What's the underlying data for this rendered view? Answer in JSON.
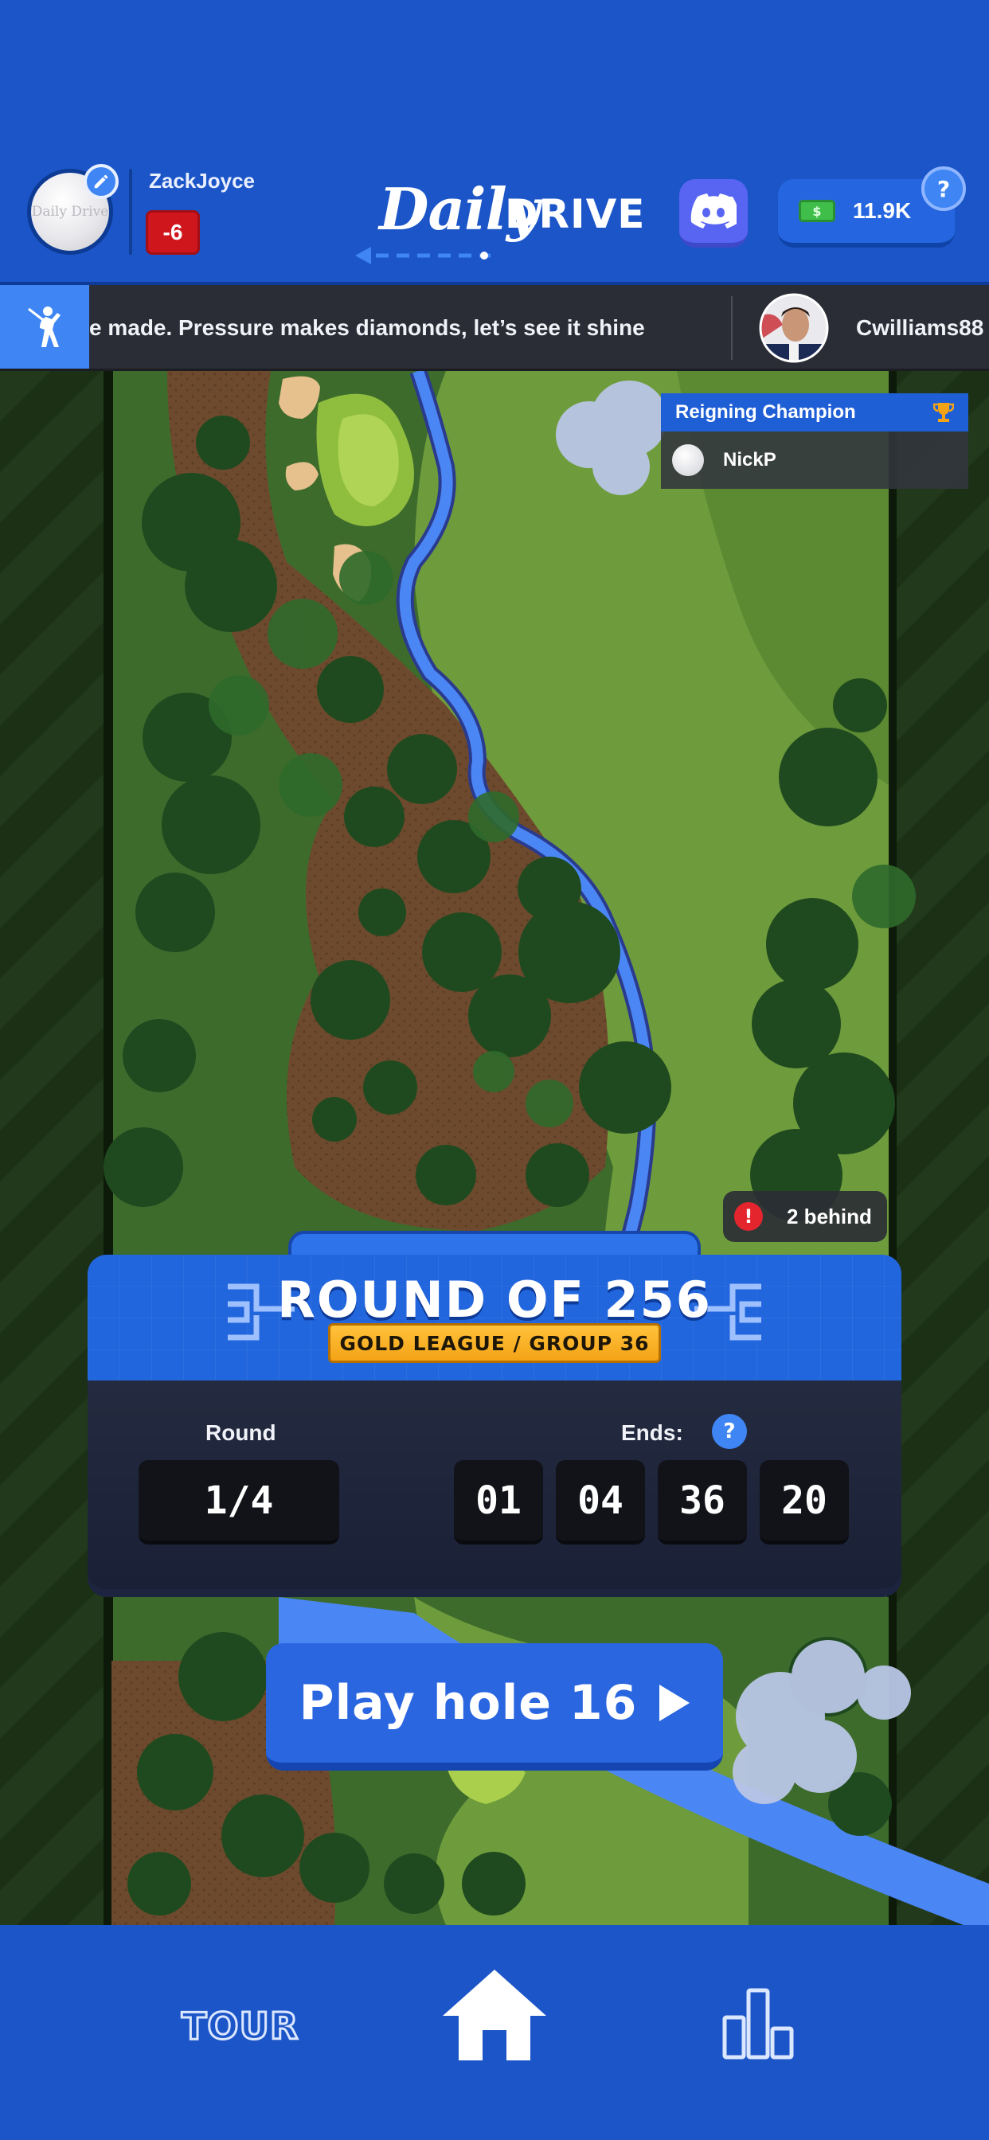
{
  "header": {
    "username": "ZackJoyce",
    "score": "-6",
    "avatar_logo": "Daily Drive",
    "logo_daily": "Daily",
    "logo_drive": "DRIVE",
    "cash": "11.9K",
    "help": "?",
    "icons": [
      "golf-ball-avatar",
      "pencil-icon",
      "discord-icon",
      "cash-icon",
      "help-icon"
    ]
  },
  "ticker": {
    "message": "e made. Pressure makes diamonds, let’s see it shine",
    "username": "Cwilliams88"
  },
  "champion": {
    "title": "Reigning Champion",
    "name": "NickP"
  },
  "status": {
    "behind": "2 behind",
    "alert": "!"
  },
  "round": {
    "title": "ROUND OF 256",
    "league": "GOLD LEAGUE / GROUP 36",
    "round_label": "Round",
    "round_value": "1/4",
    "ends_label": "Ends:",
    "ends_help": "?",
    "timer": [
      "01",
      "04",
      "36",
      "20"
    ]
  },
  "play": {
    "label": "Play hole 16"
  },
  "nav": {
    "tour": "TOUR",
    "icons": [
      "home-icon",
      "leaderboard-icon"
    ]
  },
  "colors": {
    "brand_blue": "#1b55c7",
    "accent_blue": "#3f86f4",
    "score_red": "#d0161d",
    "gold": "#f4a316",
    "discord": "#5865f2"
  }
}
